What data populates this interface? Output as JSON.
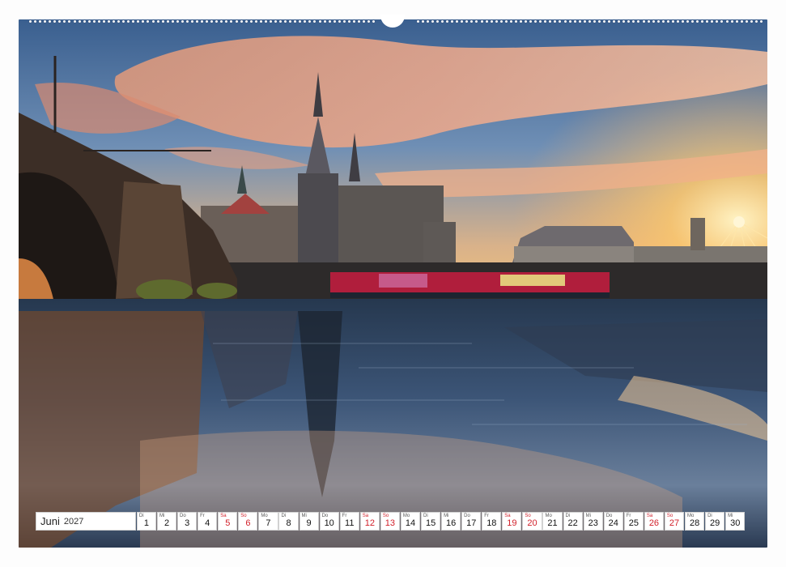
{
  "calendar": {
    "month": "Juni",
    "year": "2027",
    "days": [
      {
        "wd": "Di",
        "num": "1",
        "weekend": false
      },
      {
        "wd": "Mi",
        "num": "2",
        "weekend": false
      },
      {
        "wd": "Do",
        "num": "3",
        "weekend": false
      },
      {
        "wd": "Fr",
        "num": "4",
        "weekend": false
      },
      {
        "wd": "Sa",
        "num": "5",
        "weekend": true
      },
      {
        "wd": "So",
        "num": "6",
        "weekend": true
      },
      {
        "wd": "Mo",
        "num": "7",
        "weekend": false
      },
      {
        "wd": "Di",
        "num": "8",
        "weekend": false
      },
      {
        "wd": "Mi",
        "num": "9",
        "weekend": false
      },
      {
        "wd": "Do",
        "num": "10",
        "weekend": false
      },
      {
        "wd": "Fr",
        "num": "11",
        "weekend": false
      },
      {
        "wd": "Sa",
        "num": "12",
        "weekend": true
      },
      {
        "wd": "So",
        "num": "13",
        "weekend": true
      },
      {
        "wd": "Mo",
        "num": "14",
        "weekend": false
      },
      {
        "wd": "Di",
        "num": "15",
        "weekend": false
      },
      {
        "wd": "Mi",
        "num": "16",
        "weekend": false
      },
      {
        "wd": "Do",
        "num": "17",
        "weekend": false
      },
      {
        "wd": "Fr",
        "num": "18",
        "weekend": false
      },
      {
        "wd": "Sa",
        "num": "19",
        "weekend": true
      },
      {
        "wd": "So",
        "num": "20",
        "weekend": true
      },
      {
        "wd": "Mo",
        "num": "21",
        "weekend": false
      },
      {
        "wd": "Di",
        "num": "22",
        "weekend": false
      },
      {
        "wd": "Mi",
        "num": "23",
        "weekend": false
      },
      {
        "wd": "Do",
        "num": "24",
        "weekend": false
      },
      {
        "wd": "Fr",
        "num": "25",
        "weekend": false
      },
      {
        "wd": "Sa",
        "num": "26",
        "weekend": true
      },
      {
        "wd": "So",
        "num": "27",
        "weekend": true
      },
      {
        "wd": "Mo",
        "num": "28",
        "weekend": false
      },
      {
        "wd": "Di",
        "num": "29",
        "weekend": false
      },
      {
        "wd": "Mi",
        "num": "30",
        "weekend": false
      }
    ]
  },
  "colors": {
    "weekend": "#d2202a",
    "weekday": "#111111"
  }
}
